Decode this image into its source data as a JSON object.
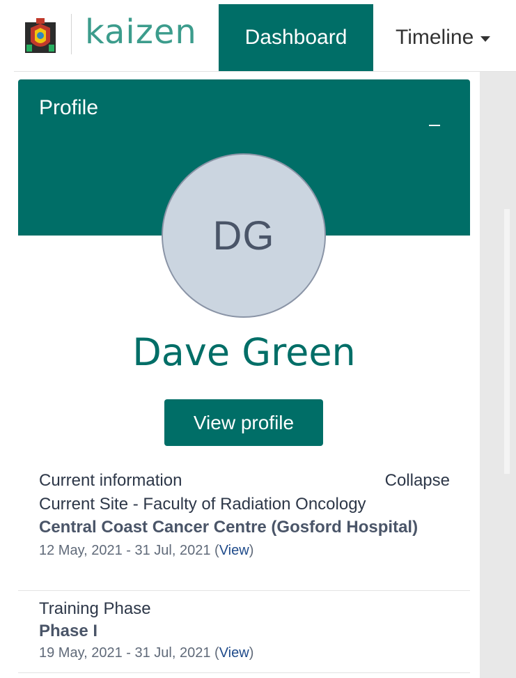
{
  "nav": {
    "logo_text": "kaizen",
    "dashboard_label": "Dashboard",
    "timeline_label": "Timeline",
    "crest_icon": "crest-icon"
  },
  "profile": {
    "title": "Profile",
    "initials": "DG",
    "name": "Dave Green",
    "view_profile_label": "View profile"
  },
  "current_info": {
    "heading": "Current information",
    "collapse_label": "Collapse",
    "site_line": "Current Site - Faculty of Radiation Oncology",
    "site_name": "Central Coast Cancer Centre (Gosford Hospital)",
    "dates": "12 May, 2021 - 31 Jul, 2021",
    "view_label": "View"
  },
  "training_phase": {
    "label": "Training Phase",
    "value": "Phase I",
    "dates": "19 May, 2021 - 31 Jul, 2021",
    "view_label": "View"
  },
  "colors": {
    "brand": "#006e67",
    "logo": "#3c9c8c",
    "avatar_bg": "#cbd5e0"
  }
}
